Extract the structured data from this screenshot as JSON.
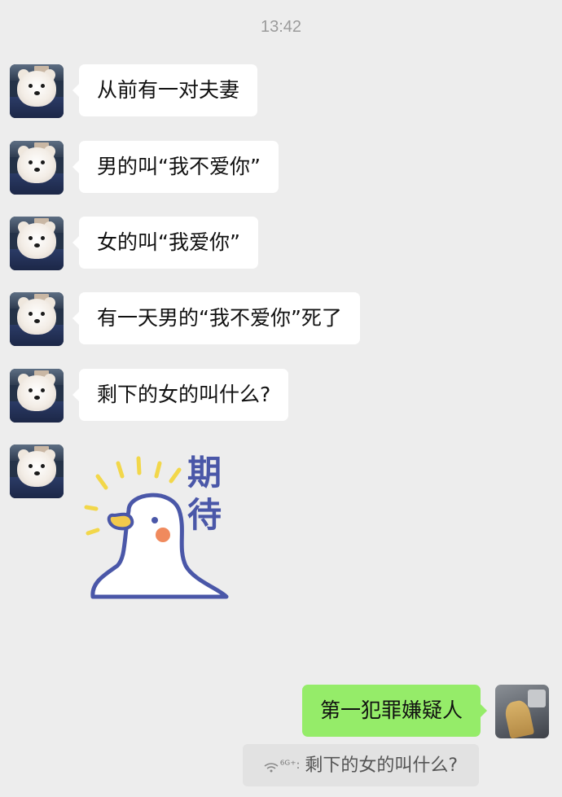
{
  "timestamp": "13:42",
  "messages": [
    {
      "text": "从前有一对夫妻"
    },
    {
      "text": "男的叫“我不爱你”"
    },
    {
      "text": "女的叫“我爱你”"
    },
    {
      "text": "有一天男的“我不爱你”死了"
    },
    {
      "text": "剩下的女的叫什么?"
    }
  ],
  "sticker": {
    "title": "期待",
    "icon": "duck-sticker-icon",
    "colors": {
      "outline": "#4a57a8",
      "beak": "#f2c94c",
      "cheek": "#f08a5d",
      "rays": "#f2d74a"
    }
  },
  "reply": {
    "text": "第一犯罪嫌疑人",
    "quote_sender": "⁶ᴳ⁺:",
    "quote_text": "剩下的女的叫什么?"
  },
  "colors": {
    "background": "#ededed",
    "incoming_bubble": "#ffffff",
    "outgoing_bubble": "#95ec69",
    "quote_bg": "#e2e2e2"
  }
}
